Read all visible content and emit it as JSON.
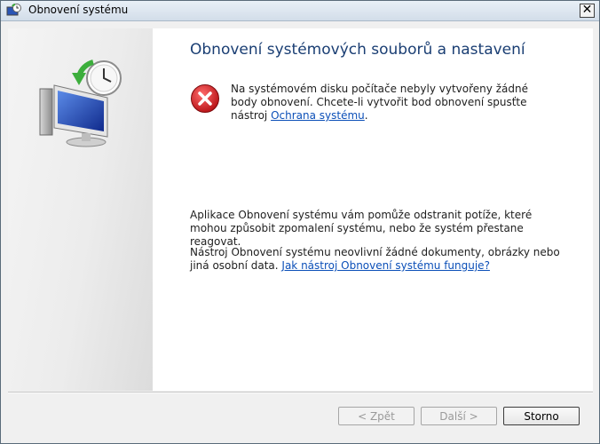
{
  "window": {
    "title": "Obnovení systému",
    "close_label": "✕"
  },
  "main": {
    "heading": "Obnovení systémových souborů a nastavení",
    "error": {
      "text_before": "Na systémovém disku počítače nebyly vytvořeny žádné body obnovení. Chcete-li vytvořit bod obnovení spusťte nástroj ",
      "link": "Ochrana systému",
      "text_after": "."
    },
    "info1": "Aplikace Obnovení systému vám pomůže odstranit potíže, které mohou způsobit zpomalení systému, nebo že systém přestane reagovat.",
    "info2_text": "Nástroj Obnovení systému neovlivní žádné dokumenty, obrázky nebo jiná osobní data. ",
    "info2_link": "Jak nástroj Obnovení systému funguje?"
  },
  "footer": {
    "back_label": "< Zpět",
    "next_label": "Další >",
    "cancel_label": "Storno"
  },
  "icons": {
    "app": "system-restore-icon",
    "error": "error-icon",
    "sidebar_art": "system-restore-monitor-clock-icon"
  },
  "colors": {
    "heading": "#1a3e73",
    "link": "#0b4fb8",
    "error_red": "#c4171b"
  }
}
